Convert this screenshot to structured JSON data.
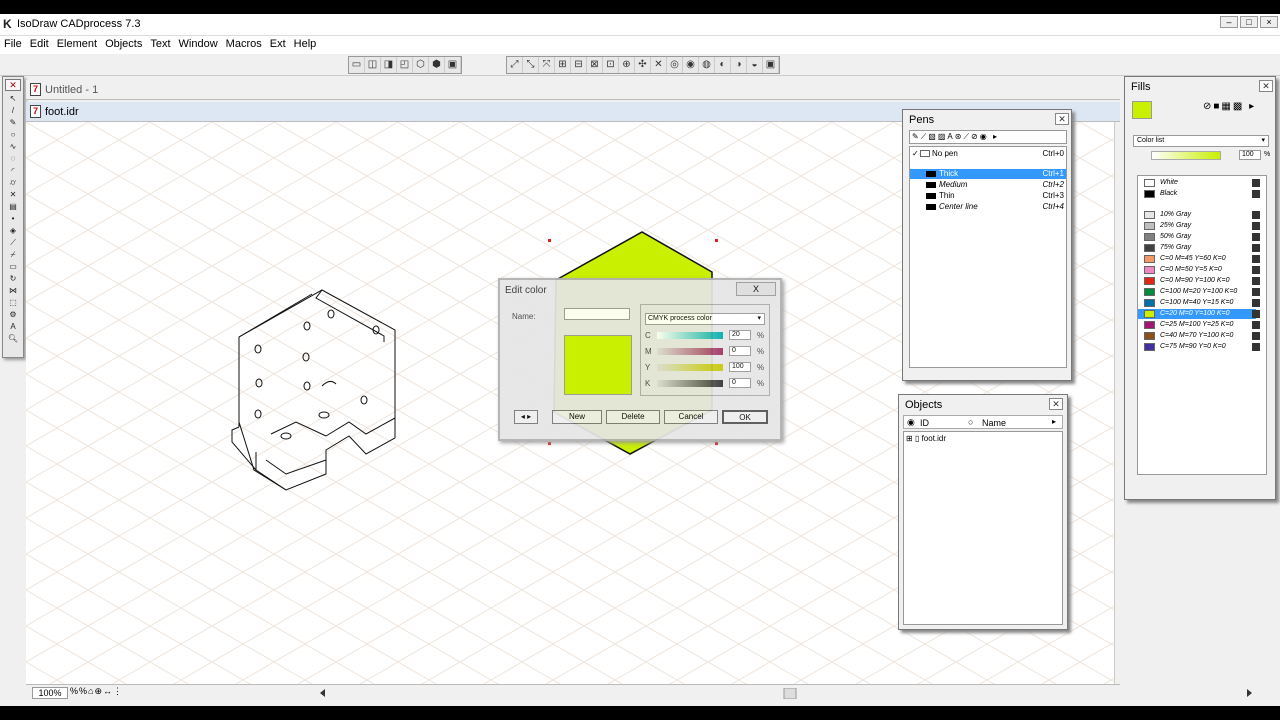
{
  "app": {
    "title": "IsoDraw CADprocess 7.3",
    "logo": "K"
  },
  "menu": [
    "File",
    "Edit",
    "Element",
    "Objects",
    "Text",
    "Window",
    "Macros",
    "Ext",
    "Help"
  ],
  "documents": [
    {
      "label": "Untitled - 1",
      "icon": "7"
    },
    {
      "label": "foot.idr",
      "icon": "7"
    }
  ],
  "statusbar": {
    "zoom": "100%",
    "icons": "%%⌂⊕↔⋮"
  },
  "pens": {
    "title": "Pens",
    "no_pen": {
      "label": "No pen",
      "shortcut": "Ctrl+0"
    },
    "items": [
      {
        "name": "Thick",
        "shortcut": "Ctrl+1",
        "selected": true
      },
      {
        "name": "Medium",
        "shortcut": "Ctrl+2",
        "selected": false
      },
      {
        "name": "Thin",
        "shortcut": "Ctrl+3",
        "selected": false
      },
      {
        "name": "Center line",
        "shortcut": "Ctrl+4",
        "selected": false
      }
    ]
  },
  "objects": {
    "title": "Objects",
    "radio_id": "ID",
    "radio_name": "Name",
    "tree_item": "foot.idr"
  },
  "fills": {
    "title": "Fills",
    "current_color": "#c8f000",
    "list_type": "Color list",
    "tint_value": "100",
    "tint_unit": "%",
    "items": [
      {
        "name": "White",
        "color": "#ffffff"
      },
      {
        "name": "Black",
        "color": "#000000"
      },
      {
        "name": "10% Gray",
        "color": "#e6e6e6"
      },
      {
        "name": "25% Gray",
        "color": "#bfbfbf"
      },
      {
        "name": "50% Gray",
        "color": "#808080"
      },
      {
        "name": "75% Gray",
        "color": "#404040"
      },
      {
        "name": "C=0 M=45 Y=60 K=0",
        "color": "#f39a6a"
      },
      {
        "name": "C=0 M=50 Y=5 K=0",
        "color": "#ee88c2"
      },
      {
        "name": "C=0 M=90 Y=100 K=0",
        "color": "#e02818"
      },
      {
        "name": "C=100 M=20 Y=100 K=0",
        "color": "#008a3c"
      },
      {
        "name": "C=100 M=40 Y=15 K=0",
        "color": "#0070a8"
      },
      {
        "name": "C=20 M=0 Y=100 K=0",
        "color": "#c8f000"
      },
      {
        "name": "C=25 M=100 Y=25 K=0",
        "color": "#a01870"
      },
      {
        "name": "C=40 M=70 Y=100 K=0",
        "color": "#8a5020"
      },
      {
        "name": "C=75 M=90 Y=0 K=0",
        "color": "#4030a0"
      }
    ],
    "selected_index": 11
  },
  "edit_color": {
    "title": "Edit color",
    "close": "X",
    "name_label": "Name:",
    "color_model": "CMYK process color",
    "channels": [
      {
        "label": "C",
        "value": "20",
        "unit": "%"
      },
      {
        "label": "M",
        "value": "0",
        "unit": "%"
      },
      {
        "label": "Y",
        "value": "100",
        "unit": "%"
      },
      {
        "label": "K",
        "value": "0",
        "unit": "%"
      }
    ],
    "buttons": {
      "new": "New",
      "delete": "Delete",
      "cancel": "Cancel",
      "ok": "OK"
    }
  },
  "colors": {
    "highlight": "#3399ff",
    "fill_green": "#c8f000"
  }
}
